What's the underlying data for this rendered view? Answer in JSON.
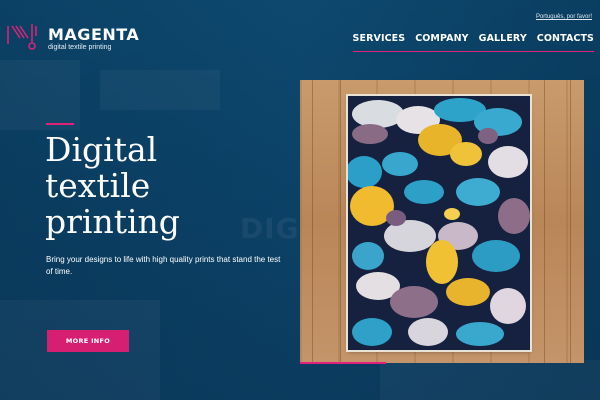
{
  "brand": {
    "name": "MAGENTA",
    "tagline": "digital textile printing",
    "logo_icon": "magenta-logo-icon"
  },
  "header": {
    "language_link": "Português, por favor!",
    "nav": [
      {
        "label": "SERVICES"
      },
      {
        "label": "COMPANY"
      },
      {
        "label": "GALLERY"
      },
      {
        "label": "CONTACTS"
      }
    ]
  },
  "hero": {
    "title": "Digital\ntextile\nprinting",
    "subtitle": "Bring your designs to life with high quality prints that stand the test of time.",
    "cta_label": "MORE INFO",
    "background_text": "DIG"
  },
  "colors": {
    "accent": "#e0227a",
    "background": "#0d4063",
    "button": "#d71f72"
  }
}
